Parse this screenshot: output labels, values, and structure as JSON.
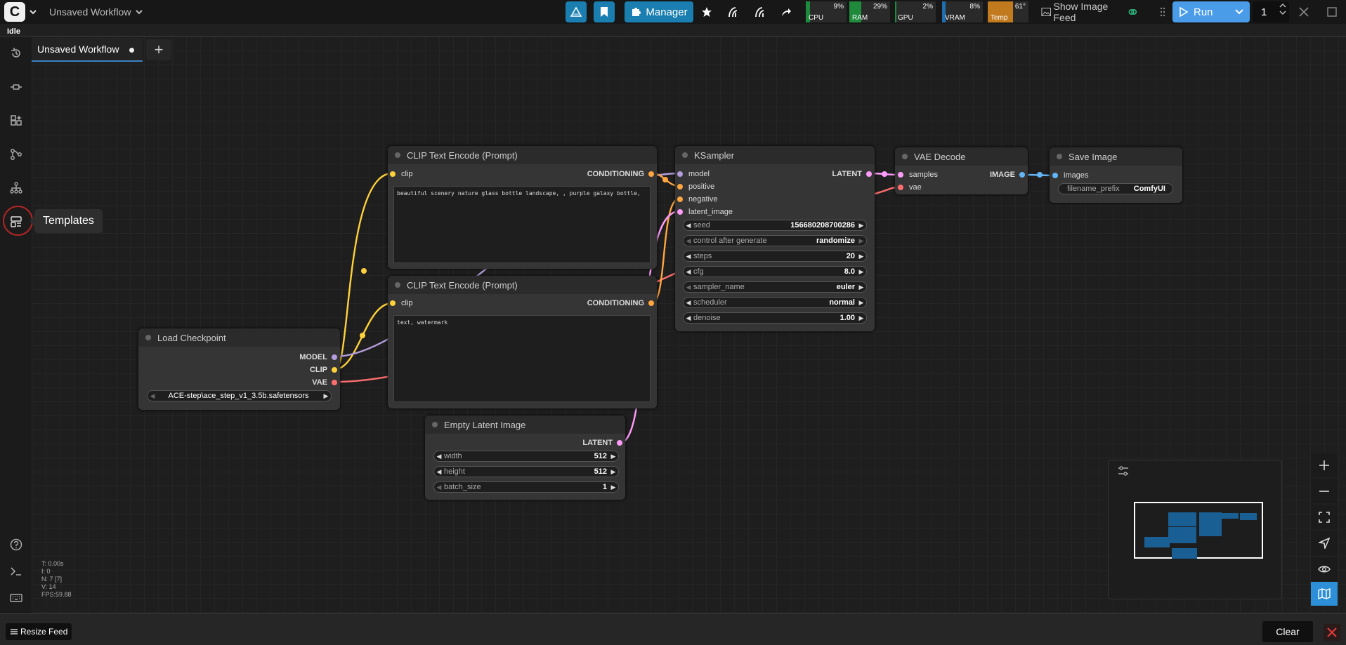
{
  "topbar": {
    "workflow_title": "Unsaved Workflow",
    "manager_label": "Manager",
    "monitors": {
      "cpu": {
        "label": "CPU",
        "value": "9%"
      },
      "ram": {
        "label": "RAM",
        "value": "29%"
      },
      "gpu": {
        "label": "GPU",
        "value": "2%"
      },
      "vram": {
        "label": "VRAM",
        "value": "8%"
      },
      "temp": {
        "label": "Temp",
        "value": "61°"
      }
    },
    "show_image_feed": "Show Image Feed",
    "run_label": "Run",
    "queue_count": "1"
  },
  "status": "Idle",
  "tabs": {
    "active": "Unsaved Workflow",
    "add": "+"
  },
  "sidebar": {
    "tooltip": "Templates"
  },
  "nodes": {
    "clip_pos": {
      "title": "CLIP Text Encode (Prompt)",
      "input": "clip",
      "output": "CONDITIONING",
      "text": "beautiful scenery nature glass bottle landscape, , purple galaxy bottle,"
    },
    "clip_neg": {
      "title": "CLIP Text Encode (Prompt)",
      "input": "clip",
      "output": "CONDITIONING",
      "text": "text, watermark"
    },
    "ksampler": {
      "title": "KSampler",
      "inputs": [
        "model",
        "positive",
        "negative",
        "latent_image"
      ],
      "output": "LATENT",
      "widgets": [
        {
          "name": "seed",
          "value": "156680208700286"
        },
        {
          "name": "control after generate",
          "value": "randomize"
        },
        {
          "name": "steps",
          "value": "20"
        },
        {
          "name": "cfg",
          "value": "8.0"
        },
        {
          "name": "sampler_name",
          "value": "euler"
        },
        {
          "name": "scheduler",
          "value": "normal"
        },
        {
          "name": "denoise",
          "value": "1.00"
        }
      ]
    },
    "vae_decode": {
      "title": "VAE Decode",
      "inputs": [
        "samples",
        "vae"
      ],
      "output": "IMAGE"
    },
    "save_image": {
      "title": "Save Image",
      "input": "images",
      "widget": {
        "name": "filename_prefix",
        "value": "ComfyUI"
      }
    },
    "load_checkpoint": {
      "title": "Load Checkpoint",
      "outputs": [
        "MODEL",
        "CLIP",
        "VAE"
      ],
      "ckpt": "ACE-step\\ace_step_v1_3.5b.safetensors"
    },
    "empty_latent": {
      "title": "Empty Latent Image",
      "output": "LATENT",
      "widgets": [
        {
          "name": "width",
          "value": "512"
        },
        {
          "name": "height",
          "value": "512"
        },
        {
          "name": "batch_size",
          "value": "1"
        }
      ]
    }
  },
  "stats": {
    "t": "T: 0.00s",
    "i": "I: 0",
    "n": "N: 7 [7]",
    "v": "V: 14",
    "fps": "FPS:59.88"
  },
  "bottom": {
    "resize_feed": "Resize Feed",
    "clear": "Clear"
  },
  "colors": {
    "accent_blue": "#1a7fb0",
    "run_blue": "#4a9ce8",
    "clip_yellow": "#ffd13a",
    "conditioning_orange": "#ffa640",
    "model_purple": "#b39ddb",
    "latent_pink": "#ff9cf9",
    "vae_red": "#ff6e6e",
    "image_blue": "#64b5f6"
  }
}
